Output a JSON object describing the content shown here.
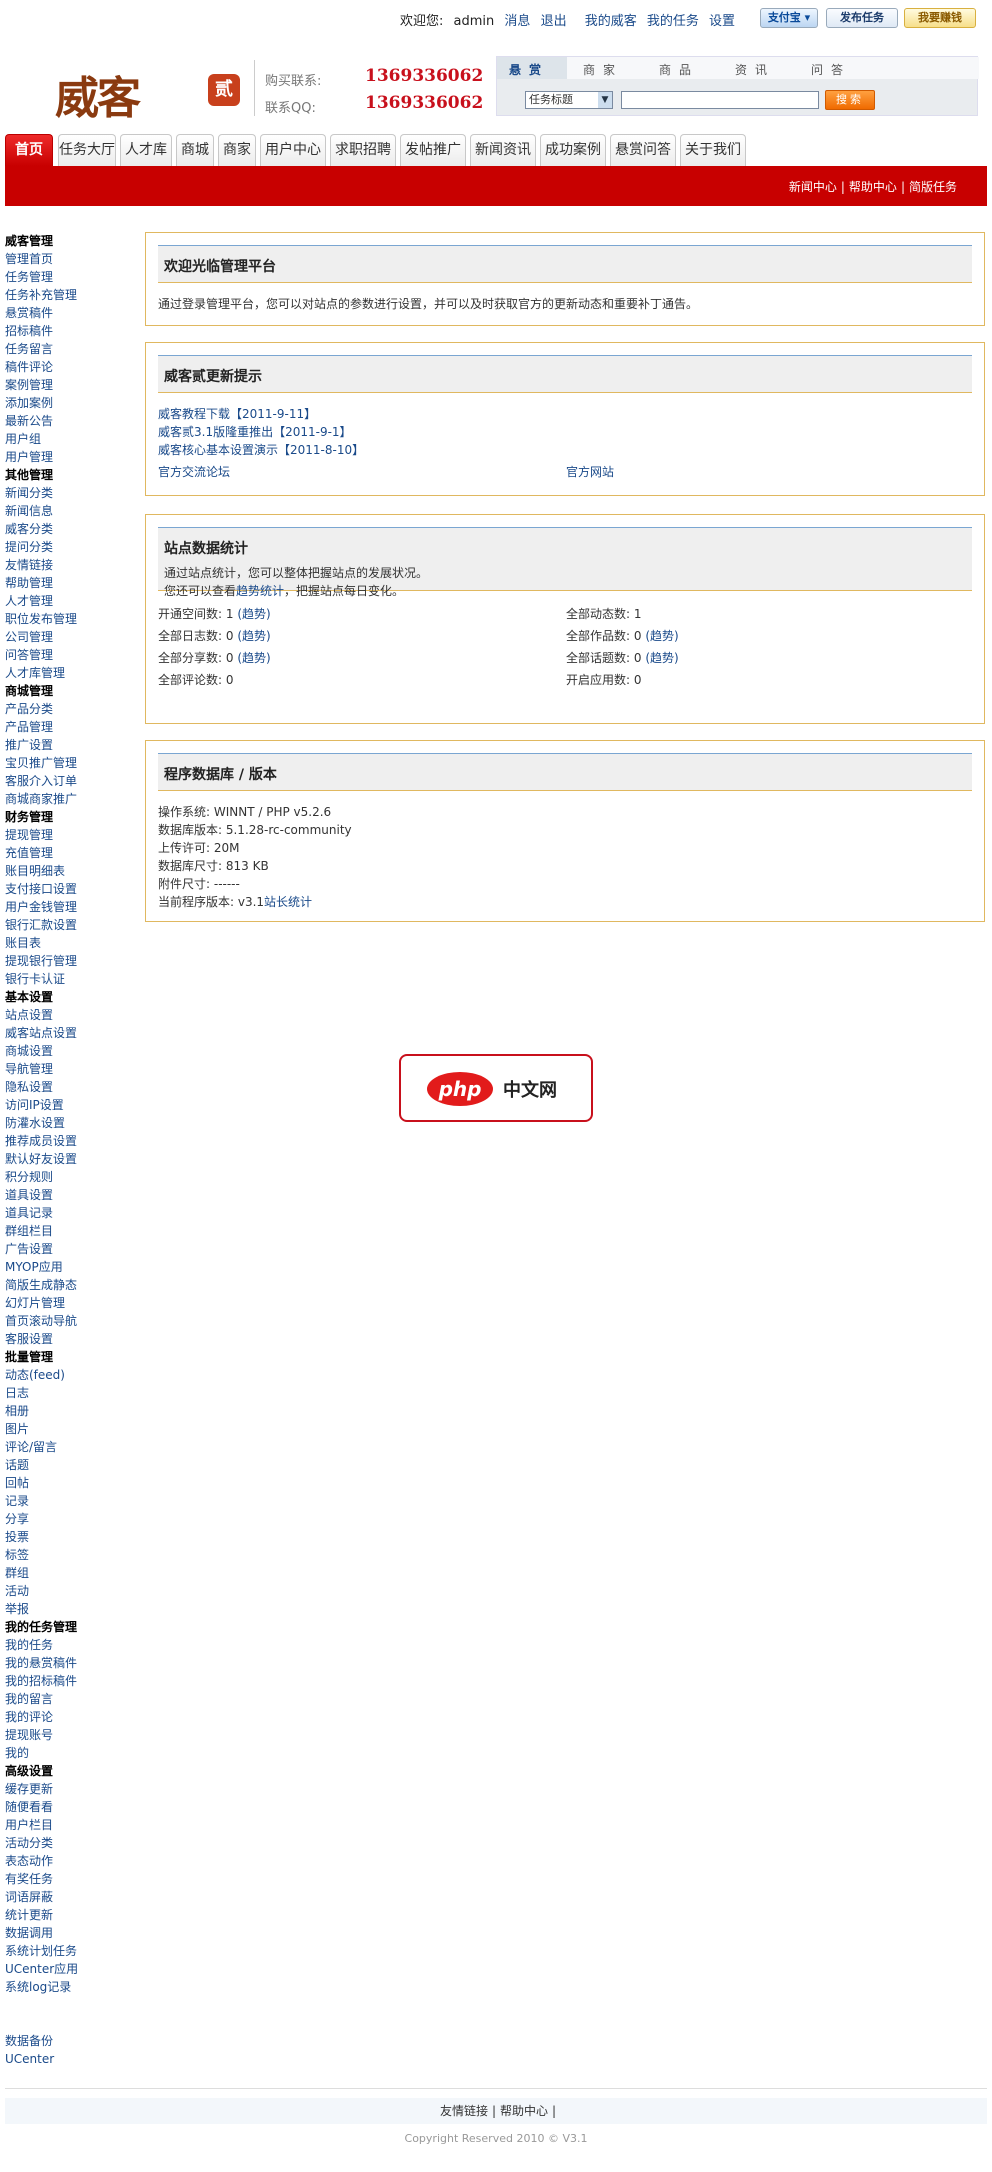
{
  "topbar": {
    "welcome": "欢迎您:",
    "user": "admin",
    "messages": "消息",
    "logout": "退出",
    "my_weike": "我的威客",
    "my_tasks": "我的任务",
    "settings": "设置",
    "alipay_btn": "支付宝",
    "post_task_btn": "发布任务",
    "earn_btn": "我要赚钱"
  },
  "header": {
    "logo_text": "威客",
    "logo_badge": "贰",
    "buy_label": "购买联系:",
    "buy_number": "1369336062",
    "qq_label": "联系QQ:",
    "qq_number": "1369336062"
  },
  "search": {
    "tabs": [
      "悬赏",
      "商家",
      "商品",
      "资讯",
      "问答"
    ],
    "select_value": "任务标题",
    "button": "搜索"
  },
  "nav": {
    "items": [
      "首页",
      "任务大厅",
      "人才库",
      "商城",
      "商家",
      "用户中心",
      "求职招聘",
      "发帖推广",
      "新闻资讯",
      "成功案例",
      "悬赏问答",
      "关于我们"
    ],
    "sub_links": [
      "新闻中心",
      "帮助中心",
      "简版任务"
    ]
  },
  "sidebar": {
    "items": [
      {
        "t": "威客管理",
        "h": true
      },
      {
        "t": "管理首页"
      },
      {
        "t": "任务管理"
      },
      {
        "t": "任务补充管理"
      },
      {
        "t": "悬赏稿件"
      },
      {
        "t": "招标稿件"
      },
      {
        "t": "任务留言"
      },
      {
        "t": "稿件评论"
      },
      {
        "t": "案例管理"
      },
      {
        "t": "添加案例"
      },
      {
        "t": "最新公告"
      },
      {
        "t": "用户组"
      },
      {
        "t": "用户管理"
      },
      {
        "t": "其他管理",
        "h": true
      },
      {
        "t": "新闻分类"
      },
      {
        "t": "新闻信息"
      },
      {
        "t": "威客分类"
      },
      {
        "t": "提问分类"
      },
      {
        "t": "友情链接"
      },
      {
        "t": "帮助管理"
      },
      {
        "t": "人才管理"
      },
      {
        "t": "职位发布管理"
      },
      {
        "t": "公司管理"
      },
      {
        "t": "问答管理"
      },
      {
        "t": "人才库管理"
      },
      {
        "t": "商城管理",
        "h": true
      },
      {
        "t": "产品分类"
      },
      {
        "t": "产品管理"
      },
      {
        "t": "推广设置"
      },
      {
        "t": "宝贝推广管理"
      },
      {
        "t": "客服介入订单"
      },
      {
        "t": "商城商家推广"
      },
      {
        "t": "财务管理",
        "h": true
      },
      {
        "t": "提现管理"
      },
      {
        "t": "充值管理"
      },
      {
        "t": "账目明细表"
      },
      {
        "t": "支付接口设置"
      },
      {
        "t": "用户金钱管理"
      },
      {
        "t": "银行汇款设置"
      },
      {
        "t": "账目表"
      },
      {
        "t": "提现银行管理"
      },
      {
        "t": "银行卡认证"
      },
      {
        "t": "基本设置",
        "h": true
      },
      {
        "t": "站点设置"
      },
      {
        "t": "威客站点设置"
      },
      {
        "t": "商城设置"
      },
      {
        "t": "导航管理"
      },
      {
        "t": "隐私设置"
      },
      {
        "t": "访问IP设置"
      },
      {
        "t": "防灌水设置"
      },
      {
        "t": "推荐成员设置"
      },
      {
        "t": "默认好友设置"
      },
      {
        "t": "积分规则"
      },
      {
        "t": "道具设置"
      },
      {
        "t": "道具记录"
      },
      {
        "t": "群组栏目"
      },
      {
        "t": "广告设置"
      },
      {
        "t": "MYOP应用"
      },
      {
        "t": "简版生成静态"
      },
      {
        "t": "幻灯片管理"
      },
      {
        "t": "首页滚动导航"
      },
      {
        "t": "客服设置"
      },
      {
        "t": "批量管理",
        "h": true
      },
      {
        "t": "动态(feed)"
      },
      {
        "t": "日志"
      },
      {
        "t": "相册"
      },
      {
        "t": "图片"
      },
      {
        "t": "评论/留言"
      },
      {
        "t": "话题"
      },
      {
        "t": "回帖"
      },
      {
        "t": "记录"
      },
      {
        "t": "分享"
      },
      {
        "t": "投票"
      },
      {
        "t": "标签"
      },
      {
        "t": "群组"
      },
      {
        "t": "活动"
      },
      {
        "t": "举报"
      },
      {
        "t": "我的任务管理",
        "h": true
      },
      {
        "t": "我的任务"
      },
      {
        "t": "我的悬赏稿件"
      },
      {
        "t": "我的招标稿件"
      },
      {
        "t": "我的留言"
      },
      {
        "t": "我的评论"
      },
      {
        "t": "提现账号"
      },
      {
        "t": "我的"
      },
      {
        "t": "高级设置",
        "h": true
      },
      {
        "t": "缓存更新"
      },
      {
        "t": "随便看看"
      },
      {
        "t": "用户栏目"
      },
      {
        "t": "活动分类"
      },
      {
        "t": "表态动作"
      },
      {
        "t": "有奖任务"
      },
      {
        "t": "词语屏蔽"
      },
      {
        "t": "统计更新"
      },
      {
        "t": "数据调用"
      },
      {
        "t": "系统计划任务"
      },
      {
        "t": "UCenter应用"
      },
      {
        "t": "系统log记录"
      },
      {
        "t": "",
        "gap": true
      },
      {
        "t": "数据备份"
      },
      {
        "t": "UCenter"
      }
    ]
  },
  "welcome_panel": {
    "title": "欢迎光临管理平台",
    "text": "通过登录管理平台，您可以对站点的参数进行设置，并可以及时获取官方的更新动态和重要补丁通告。"
  },
  "update_panel": {
    "title": "威客贰更新提示",
    "links": [
      "威客教程下载【2011-9-11】",
      "威客贰3.1版隆重推出【2011-9-1】",
      "威客核心基本设置演示【2011-8-10】"
    ],
    "forum": "官方交流论坛",
    "site": "官方网站"
  },
  "stats_panel": {
    "title": "站点数据统计",
    "sub1": "通过站点统计，您可以整体把握站点的发展状况。",
    "sub2_a": "您还可以查看",
    "sub2_link": "趋势统计",
    "sub2_b": "，把握站点每日变化。",
    "trend": "(趋势)",
    "left": [
      {
        "label": "开通空间数: 1",
        "trend": true
      },
      {
        "label": "全部日志数: 0",
        "trend": true
      },
      {
        "label": "全部分享数: 0",
        "trend": true
      },
      {
        "label": "全部评论数: 0",
        "trend": false
      }
    ],
    "right": [
      {
        "label": "全部动态数: 1",
        "trend": false
      },
      {
        "label": "全部作品数: 0",
        "trend": true
      },
      {
        "label": "全部话题数: 0",
        "trend": true
      },
      {
        "label": "开启应用数: 0",
        "trend": false
      }
    ]
  },
  "db_panel": {
    "title": "程序数据库 / 版本",
    "lines": [
      "操作系统: WINNT / PHP v5.2.6",
      "数据库版本: 5.1.28-rc-community",
      "上传许可: 20M",
      "数据库尺寸: 813 KB",
      "附件尺寸: ------"
    ],
    "version_label": "当前程序版本: v3.1",
    "version_link": "站长统计"
  },
  "watermark": {
    "logo": "php",
    "text": "中文网"
  },
  "footer": {
    "links": [
      "友情链接",
      "帮助中心"
    ],
    "copyright": "Copyright Reserved 2010 © V3.1"
  }
}
